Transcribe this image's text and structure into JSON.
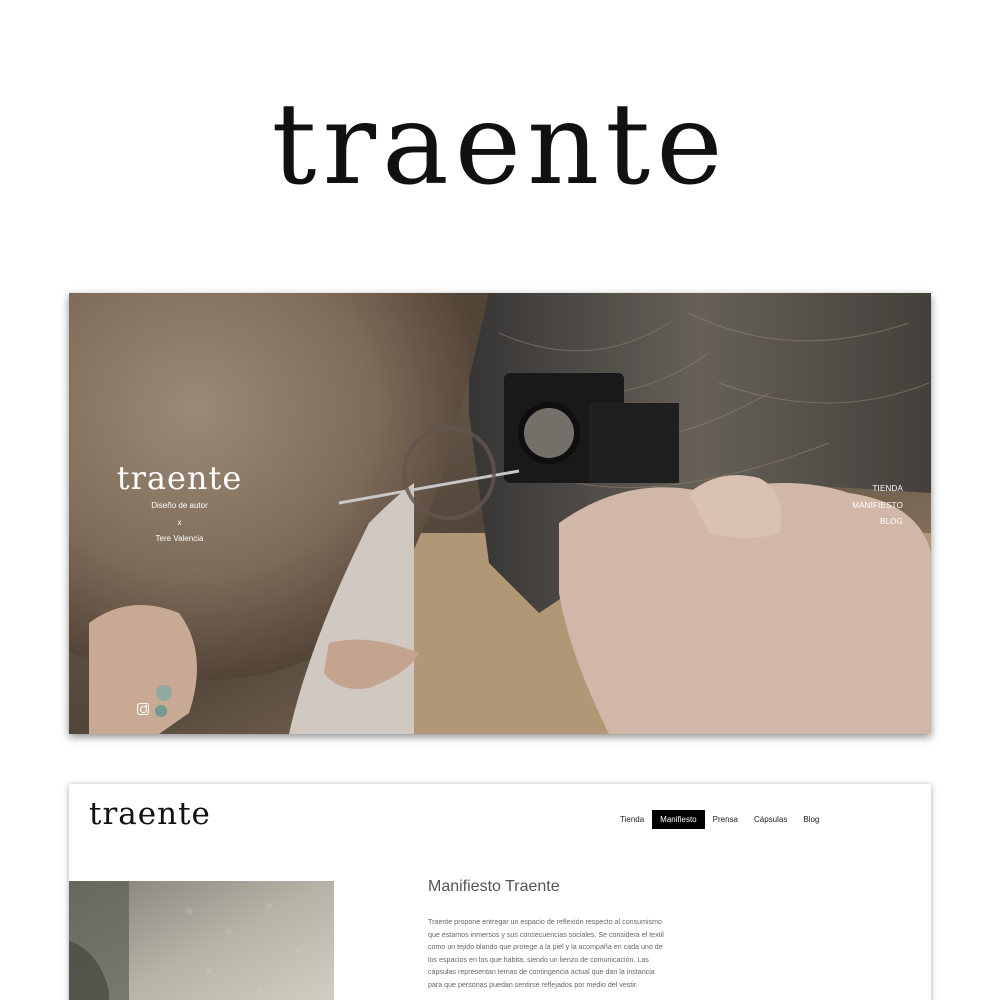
{
  "brand": {
    "wordmark": "traente"
  },
  "hero": {
    "logo": "traente",
    "tagline_line1": "Diseño de autor",
    "tagline_line2": "x",
    "tagline_line3": "Tere Valencia",
    "nav": [
      "TIENDA",
      "MANIFIESTO",
      "BLOG"
    ],
    "social_icon": "instagram-icon"
  },
  "manifesto_page": {
    "logo": "traente",
    "nav": {
      "items": [
        "Tienda",
        "Manifiesto",
        "Prensa",
        "Cápsulas",
        "Blog"
      ],
      "active": "Manifiesto"
    },
    "title": "Manifiesto Traente",
    "body": "Traente propone entregar un espacio de reflexión respecto al consumismo que estamos inmersos y sus consecuencias sociales. Se considera el textil como un tejido blando que protege a la piel y la acompaña en cada uno de los espacios en los que habita, siendo un lienzo de comunicación. Las cápsulas representan temas de contingencia actual que dan la instancia para que personas puedan sentirse reflejados por medio del vestir."
  },
  "colors": {
    "background": "#ffffff",
    "text_dark": "#111111",
    "nav_active_bg": "#000000",
    "nav_active_text": "#ffffff"
  }
}
